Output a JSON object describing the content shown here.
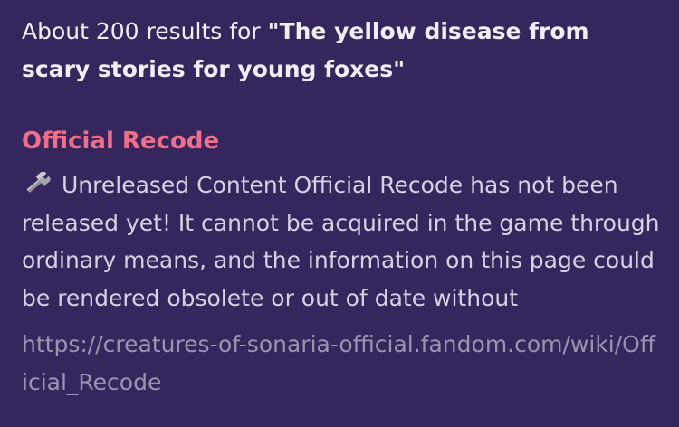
{
  "search": {
    "summary_prefix": "About 200 results for ",
    "query": "\"The yellow disease from scary stories for young foxes\""
  },
  "result": {
    "title": "Official Recode",
    "snippet_icon": "wrench-icon",
    "snippet": "Unreleased Content Official Recode has not been released yet! It cannot be acquired in the game through ordinary means, and the information on this page could be rendered obsolete or out of date without",
    "url": "https://creatures-of-sonaria-official.fandom.com/wiki/Official_Recode"
  },
  "colors": {
    "background": "#35275d",
    "title": "#ef6f8a",
    "url": "#9c93b1",
    "text": "#ece8f2"
  }
}
